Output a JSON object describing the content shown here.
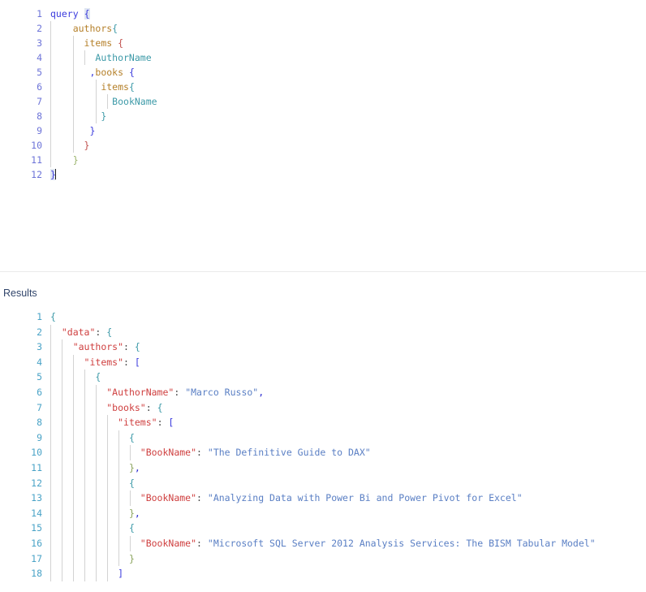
{
  "editor": {
    "name": "graphql-query-editor",
    "line_numbers": [
      "1",
      "2",
      "3",
      "4",
      "5",
      "6",
      "7",
      "8",
      "9",
      "10",
      "11",
      "12"
    ],
    "lines": [
      {
        "n": "1",
        "indent": 0,
        "text": "query {"
      },
      {
        "n": "2",
        "indent": 1,
        "text": "authors{"
      },
      {
        "n": "3",
        "indent": 2,
        "text": "items {"
      },
      {
        "n": "4",
        "indent": 3,
        "text": "AuthorName"
      },
      {
        "n": "5",
        "indent": 3,
        "text": ",books {"
      },
      {
        "n": "6",
        "indent": 4,
        "text": "items{"
      },
      {
        "n": "7",
        "indent": 5,
        "text": "BookName"
      },
      {
        "n": "8",
        "indent": 4,
        "text": "}"
      },
      {
        "n": "9",
        "indent": 3,
        "text": "}"
      },
      {
        "n": "10",
        "indent": 2,
        "text": "}"
      },
      {
        "n": "11",
        "indent": 1,
        "text": "}"
      },
      {
        "n": "12",
        "indent": 0,
        "text": "}"
      }
    ],
    "tokens": {
      "keyword": "query",
      "open_brace": "{",
      "close_brace": "}",
      "field_authors": "authors",
      "field_items": "items",
      "field_books": "books",
      "leaf_author_name": "AuthorName",
      "leaf_book_name": "BookName",
      "comma": ","
    }
  },
  "results": {
    "label": "Results",
    "line_numbers": [
      "1",
      "2",
      "3",
      "4",
      "5",
      "6",
      "7",
      "8",
      "9",
      "10",
      "11",
      "12",
      "13",
      "14",
      "15",
      "16",
      "17",
      "18"
    ],
    "json": {
      "data": {
        "authors": {
          "items": [
            {
              "AuthorName": "Marco Russo",
              "books": {
                "items": [
                  {
                    "BookName": "The Definitive Guide to DAX"
                  },
                  {
                    "BookName": "Analyzing Data with Power Bi and Power Pivot for Excel"
                  },
                  {
                    "BookName": "Microsoft SQL Server 2012 Analysis Services: The BISM Tabular Model"
                  }
                ]
              }
            }
          ]
        }
      }
    },
    "lines": [
      {
        "n": "1",
        "guides": 0,
        "pad": 0,
        "key": "",
        "sep": "",
        "val": "",
        "tail": "",
        "open": "{",
        "close": ""
      },
      {
        "n": "2",
        "guides": 1,
        "pad": 2,
        "key": "\"data\"",
        "sep": ": ",
        "val": "",
        "tail": "",
        "open": "{",
        "close": ""
      },
      {
        "n": "3",
        "guides": 2,
        "pad": 4,
        "key": "\"authors\"",
        "sep": ": ",
        "val": "",
        "tail": "",
        "open": "{",
        "close": ""
      },
      {
        "n": "4",
        "guides": 3,
        "pad": 6,
        "key": "\"items\"",
        "sep": ": ",
        "val": "",
        "tail": "",
        "open": "[",
        "close": ""
      },
      {
        "n": "5",
        "guides": 4,
        "pad": 8,
        "key": "",
        "sep": "",
        "val": "",
        "tail": "",
        "open": "{",
        "close": ""
      },
      {
        "n": "6",
        "guides": 5,
        "pad": 10,
        "key": "\"AuthorName\"",
        "sep": ": ",
        "val": "\"Marco Russo\"",
        "tail": ",",
        "open": "",
        "close": ""
      },
      {
        "n": "7",
        "guides": 5,
        "pad": 10,
        "key": "\"books\"",
        "sep": ": ",
        "val": "",
        "tail": "",
        "open": "{",
        "close": ""
      },
      {
        "n": "8",
        "guides": 6,
        "pad": 12,
        "key": "\"items\"",
        "sep": ": ",
        "val": "",
        "tail": "",
        "open": "[",
        "close": ""
      },
      {
        "n": "9",
        "guides": 7,
        "pad": 14,
        "key": "",
        "sep": "",
        "val": "",
        "tail": "",
        "open": "{",
        "close": ""
      },
      {
        "n": "10",
        "guides": 8,
        "pad": 16,
        "key": "\"BookName\"",
        "sep": ": ",
        "val": "\"The Definitive Guide to DAX\"",
        "tail": "",
        "open": "",
        "close": ""
      },
      {
        "n": "11",
        "guides": 7,
        "pad": 14,
        "key": "",
        "sep": "",
        "val": "",
        "tail": ",",
        "open": "",
        "close": "}"
      },
      {
        "n": "12",
        "guides": 7,
        "pad": 14,
        "key": "",
        "sep": "",
        "val": "",
        "tail": "",
        "open": "{",
        "close": ""
      },
      {
        "n": "13",
        "guides": 8,
        "pad": 16,
        "key": "\"BookName\"",
        "sep": ": ",
        "val": "\"Analyzing Data with Power Bi and Power Pivot for Excel\"",
        "tail": "",
        "open": "",
        "close": ""
      },
      {
        "n": "14",
        "guides": 7,
        "pad": 14,
        "key": "",
        "sep": "",
        "val": "",
        "tail": ",",
        "open": "",
        "close": "}"
      },
      {
        "n": "15",
        "guides": 7,
        "pad": 14,
        "key": "",
        "sep": "",
        "val": "",
        "tail": "",
        "open": "{",
        "close": ""
      },
      {
        "n": "16",
        "guides": 8,
        "pad": 16,
        "key": "\"BookName\"",
        "sep": ": ",
        "val": "\"Microsoft SQL Server 2012 Analysis Services: The BISM Tabular Model\"",
        "tail": "",
        "open": "",
        "close": ""
      },
      {
        "n": "17",
        "guides": 7,
        "pad": 14,
        "key": "",
        "sep": "",
        "val": "",
        "tail": "",
        "open": "",
        "close": "}"
      },
      {
        "n": "18",
        "guides": 6,
        "pad": 12,
        "key": "",
        "sep": "",
        "val": "",
        "tail": "",
        "open": "",
        "close": "]"
      }
    ]
  },
  "colors": {
    "keyword": "#3b3bdd",
    "field": "#b5802a",
    "leaf": "#3d9aa8",
    "json_key": "#cf3f3f",
    "json_string": "#5a7fc4",
    "gutter_query": "#6d74d8",
    "gutter_results": "#4aa3c7",
    "divider": "#ebebeb",
    "indent_guide": "#d3d3d3",
    "results_label": "#31456b",
    "background": "#ffffff"
  }
}
